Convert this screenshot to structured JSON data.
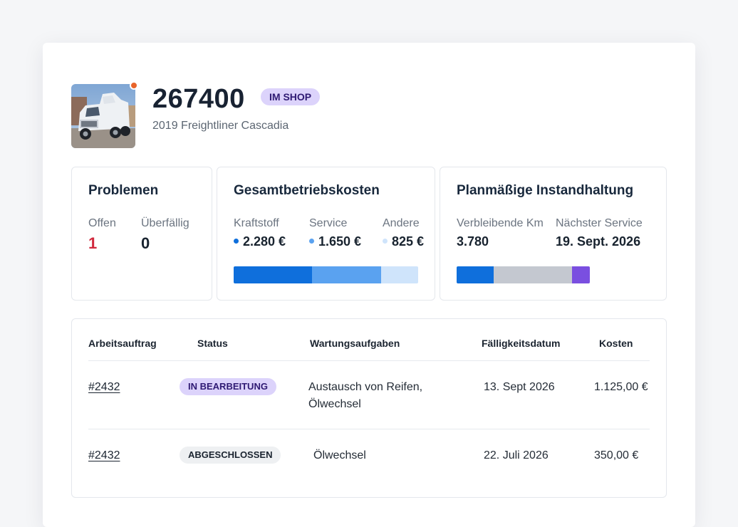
{
  "vehicle": {
    "unit_number": "267400",
    "status_badge": "IM SHOP",
    "model": "2019 Freightliner Cascadia",
    "photo_icon": "truck-photo",
    "status_dot_color": "#e8642a"
  },
  "problems": {
    "title": "Problemen",
    "open_label": "Offen",
    "open_value": "1",
    "overdue_label": "Überfällig",
    "overdue_value": "0"
  },
  "operating_costs": {
    "title": "Gesamtbetriebskosten",
    "items": [
      {
        "label": "Kraftstoff",
        "value": "2.280 €",
        "color": "#0f6fdc"
      },
      {
        "label": "Service",
        "value": "1.650 €",
        "color": "#5aa2f0"
      },
      {
        "label": "Andere",
        "value": "825 €",
        "color": "#cfe4fb"
      }
    ]
  },
  "maintenance": {
    "title": "Planmäßige Instandhaltung",
    "remaining_km_label": "Verbleibende Km",
    "remaining_km_value": "3.780",
    "next_service_label": "Nächster Service",
    "next_service_value": "19. Sept. 2026",
    "bar_colors": [
      "#0f6fdc",
      "#c4c8d0",
      "#7a4fe0"
    ]
  },
  "work_orders": {
    "headers": {
      "order": "Arbeitsauftrag",
      "status": "Status",
      "tasks": "Wartungsaufgaben",
      "due": "Fälligkeitsdatum",
      "cost": "Kosten"
    },
    "rows": [
      {
        "order": "#2432",
        "status": "IN BEARBEITUNG",
        "tasks_line1": "Austausch von Reifen,",
        "tasks_line2": "Ölwechsel",
        "due": "13. Sept 2026",
        "cost": "1.125,00 €"
      },
      {
        "order": "#2432",
        "status": "ABGESCHLOSSEN",
        "tasks_line1": "Ölwechsel",
        "tasks_line2": "",
        "due": "22. Juli 2026",
        "cost": "350,00 €"
      }
    ]
  }
}
